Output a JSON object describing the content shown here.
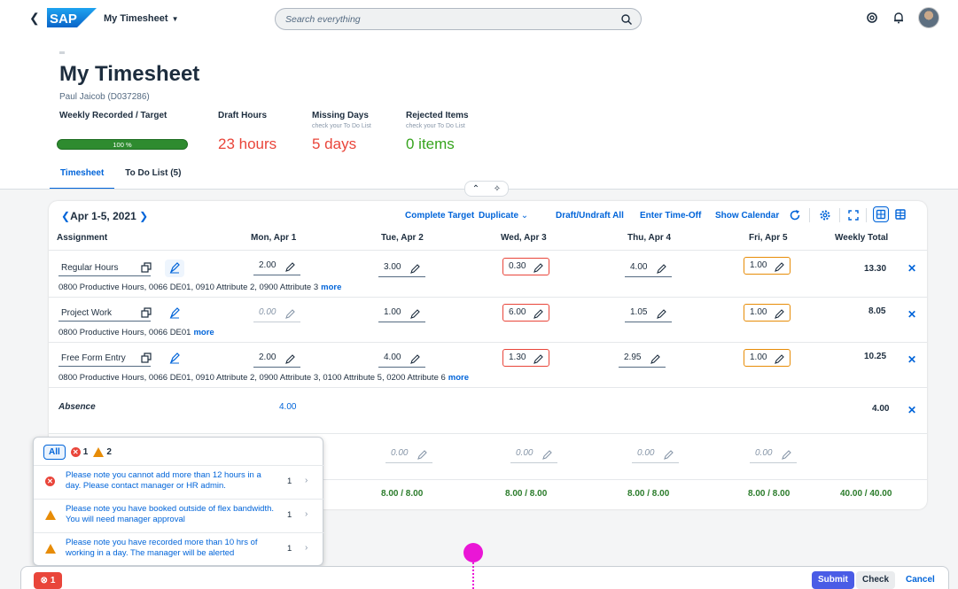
{
  "shell": {
    "logo_text": "SAP",
    "app_title": "My Timesheet",
    "search_placeholder": "Search everything"
  },
  "header": {
    "title": "My Timesheet",
    "subtitle": "Paul Jaicob (D037286)",
    "kpis": [
      {
        "label": "Weekly Recorded / Target",
        "note": "",
        "value": "100 %",
        "progress": 1.0
      },
      {
        "label": "Draft Hours",
        "note": "",
        "value": "23 hours"
      },
      {
        "label": "Missing Days",
        "note": "check your To Do List",
        "value": "5 days"
      },
      {
        "label": "Rejected Items",
        "note": "check your To Do List",
        "value": "0 items"
      }
    ]
  },
  "tabs": [
    {
      "label": "Timesheet",
      "active": true
    },
    {
      "label": "To Do List (5)",
      "active": false
    }
  ],
  "toolbar": {
    "week": "Apr 1-5, 2021",
    "complete_target": "Complete Target",
    "duplicate": "Duplicate",
    "draft_undraft": "Draft/Undraft All",
    "enter_time_off": "Enter Time-Off",
    "show_calendar": "Show Calendar"
  },
  "table": {
    "headers": [
      "Assignment",
      "Mon, Apr 1",
      "Tue, Apr 2",
      "Wed, Apr 3",
      "Thu, Apr 4",
      "Fri, Apr 5",
      "Weekly Total"
    ],
    "rows": [
      {
        "assignment": "Regular Hours",
        "cells": [
          "2.00",
          "3.00",
          "0.30",
          "4.00",
          "1.00"
        ],
        "total": "13.30",
        "desc": "0800 Productive Hours, 0066 DE01, 0910 Attribute 2, 0900 Attribute 3",
        "more": "more"
      },
      {
        "assignment": "Project Work",
        "cells": [
          "0.00",
          "1.00",
          "6.00",
          "1.05",
          "1.00"
        ],
        "total": "8.05",
        "desc": "0800 Productive Hours, 0066 DE01",
        "more": "more"
      },
      {
        "assignment": "Free Form Entry",
        "cells": [
          "2.00",
          "4.00",
          "1.30",
          "2.95",
          "1.00"
        ],
        "total": "10.25",
        "desc": "0800 Productive Hours, 0066 DE01, 0910 Attribute 2, 0900 Attribute 3, 0100 Attribute 5, 0200 Attribute 6",
        "more": "more"
      }
    ],
    "absence": {
      "label": "Absence",
      "mon": "4.00",
      "total": "4.00"
    },
    "empty_row": [
      "0.00",
      "0.00",
      "0.00",
      "0.00"
    ],
    "sums": [
      "8.00 / 8.00",
      "8.00 / 8.00",
      "8.00 / 8.00",
      "8.00 / 8.00",
      "40.00 / 40.00"
    ]
  },
  "messages": {
    "filter_all": "All",
    "error_count": "1",
    "warning_count": "2",
    "items": [
      {
        "type": "error",
        "text": "Please note you cannot add more than 12 hours in a day. Please contact manager or HR admin.",
        "count": "1"
      },
      {
        "type": "warning",
        "text": "Please note you have booked outside of flex bandwidth. You will need manager approval",
        "count": "1"
      },
      {
        "type": "warning",
        "text": "Please note you have recorded more than 10 hrs of working in a day. The manager will be alerted",
        "count": "1"
      }
    ]
  },
  "footer": {
    "error_count": "1",
    "submit": "Submit",
    "check": "Check",
    "cancel": "Cancel"
  }
}
